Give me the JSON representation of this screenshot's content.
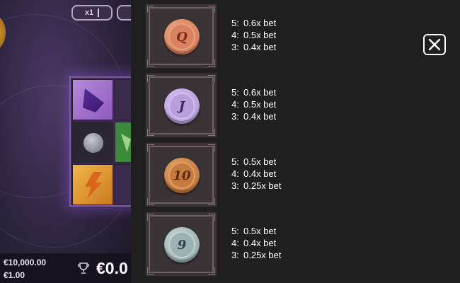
{
  "game": {
    "multiplier_label": "x1",
    "max_win": "€10,000.00",
    "bet": "€1.00",
    "win_amount": "€0.0"
  },
  "paytable": [
    {
      "symbol": "Q",
      "icon": "copper-q-coin-icon",
      "coin_color": "#d9825f",
      "face_color": "#e9a07c",
      "glyph_color": "#7a2a1c",
      "payouts": [
        {
          "count": "5:",
          "value": "0.6x bet"
        },
        {
          "count": "4:",
          "value": "0.5x bet"
        },
        {
          "count": "3:",
          "value": "0.4x bet"
        }
      ]
    },
    {
      "symbol": "J",
      "icon": "lavender-j-coin-icon",
      "coin_color": "#b9a0db",
      "face_color": "#d2bcef",
      "glyph_color": "#3a2a66",
      "payouts": [
        {
          "count": "5:",
          "value": "0.6x bet"
        },
        {
          "count": "4:",
          "value": "0.5x bet"
        },
        {
          "count": "3:",
          "value": "0.4x bet"
        }
      ]
    },
    {
      "symbol": "10",
      "icon": "bronze-10-coin-icon",
      "coin_color": "#c57a3e",
      "face_color": "#e0a065",
      "glyph_color": "#5a2a10",
      "payouts": [
        {
          "count": "5:",
          "value": "0.5x bet"
        },
        {
          "count": "4:",
          "value": "0.4x bet"
        },
        {
          "count": "3:",
          "value": "0.25x bet"
        }
      ]
    },
    {
      "symbol": "9",
      "icon": "silver-9-coin-icon",
      "coin_color": "#9db2b2",
      "face_color": "#c2d2d2",
      "glyph_color": "#2a4444",
      "payouts": [
        {
          "count": "5:",
          "value": "0.5x bet"
        },
        {
          "count": "4:",
          "value": "0.4x bet"
        },
        {
          "count": "3:",
          "value": "0.25x bet"
        }
      ]
    }
  ],
  "close_icon": "close-icon"
}
